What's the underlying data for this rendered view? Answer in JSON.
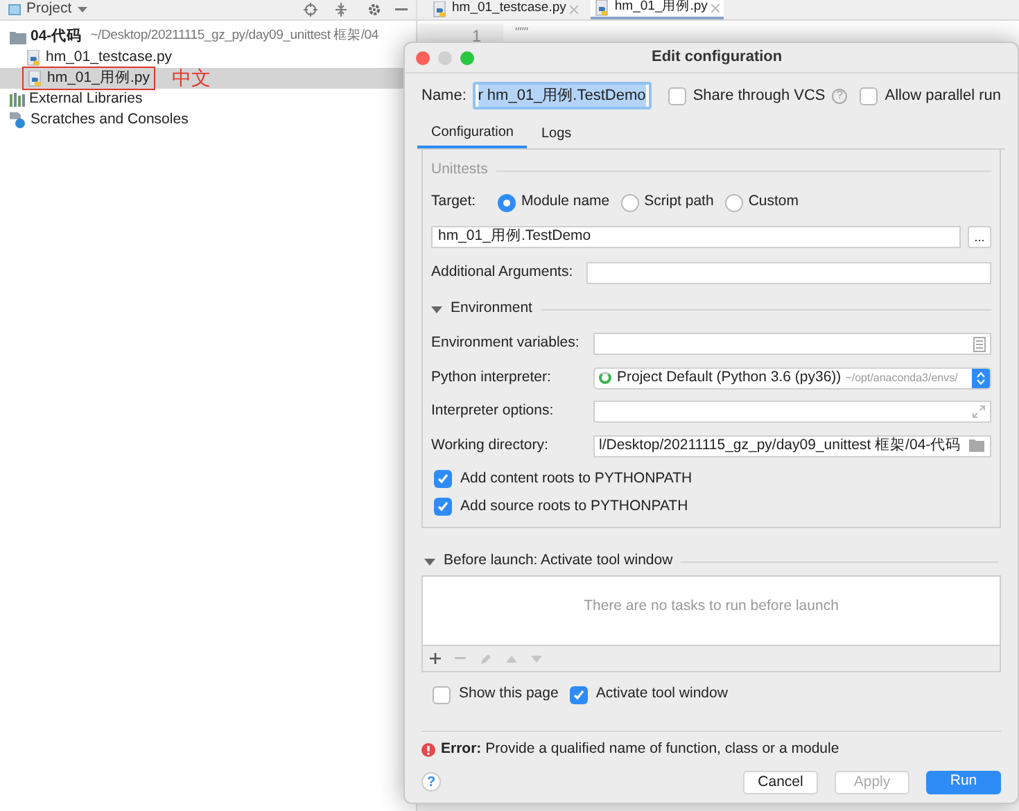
{
  "project_panel": {
    "title": "Project",
    "tree": [
      {
        "label": "04-代码",
        "path": "~/Desktop/20211115_gz_py/day09_unittest 框架/04",
        "kind": "folder",
        "selected": false,
        "children": [
          {
            "label": "hm_01_testcase.py",
            "kind": "python",
            "selected": false
          },
          {
            "label": "hm_01_用例.py",
            "kind": "python",
            "selected": true,
            "annotation": "中文"
          }
        ]
      },
      {
        "label": "External Libraries",
        "kind": "library",
        "selected": false
      },
      {
        "label": "Scratches and Consoles",
        "kind": "scratch",
        "selected": false
      }
    ]
  },
  "editor": {
    "tabs": [
      {
        "label": "hm_01_testcase.py",
        "selected": false
      },
      {
        "label": "hm_01_用例.py",
        "selected": true
      }
    ],
    "line_number": "1",
    "code": "\"\"\""
  },
  "dialog": {
    "title": "Edit configuration",
    "name": {
      "label": "Name:",
      "value": "r hm_01_用例.TestDemo"
    },
    "options": [
      {
        "label": "Share through VCS",
        "checked": false,
        "help": "?"
      },
      {
        "label": "Allow parallel run",
        "checked": false
      }
    ],
    "tabs": [
      {
        "label": "Configuration",
        "selected": true
      },
      {
        "label": "Logs",
        "selected": false
      }
    ],
    "section": "Unittests",
    "target": {
      "label": "Target:",
      "options": [
        {
          "label": "Module name",
          "selected": true
        },
        {
          "label": "Script path",
          "selected": false
        },
        {
          "label": "Custom",
          "selected": false
        }
      ]
    },
    "module": {
      "value": "hm_01_用例.TestDemo",
      "browse": "..."
    },
    "additional_arguments": {
      "label": "Additional Arguments:"
    },
    "environment": {
      "title": "Environment",
      "expanded": true,
      "fields": [
        {
          "label": "Environment variables:",
          "kind": "list"
        },
        {
          "label": "Python interpreter:",
          "kind": "select",
          "value": "Project Default (Python 3.6 (py36))",
          "hint": "~/opt/anaconda3/envs/"
        },
        {
          "label": "Interpreter options:",
          "kind": "expand"
        },
        {
          "label": "Working directory:",
          "kind": "folder",
          "value": "l/Desktop/20211115_gz_py/day09_unittest 框架/04-代码"
        }
      ]
    },
    "checkboxes": [
      {
        "label": "Add content roots to PYTHONPATH",
        "checked": true
      },
      {
        "label": "Add source roots to PYTHONPATH",
        "checked": true
      }
    ],
    "before_launch": {
      "title": "Before launch: Activate tool window",
      "expanded": true,
      "empty_text": "There are no tasks to run before launch"
    },
    "launch_options": [
      {
        "label": "Show this page",
        "checked": false
      },
      {
        "label": "Activate tool window",
        "checked": true
      }
    ],
    "error": "**Error:** Provide a qualified name of function, class or a module",
    "help": "?",
    "buttons": [
      {
        "label": "Cancel",
        "kind": "default",
        "disabled": false
      },
      {
        "label": "Apply",
        "kind": "default",
        "disabled": true
      },
      {
        "label": "Run",
        "kind": "primary",
        "disabled": false
      }
    ]
  }
}
